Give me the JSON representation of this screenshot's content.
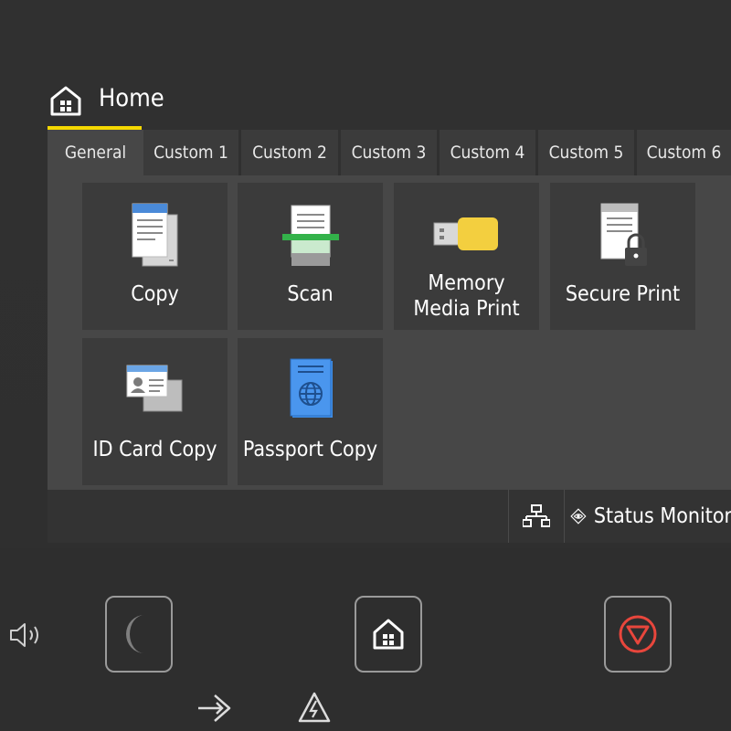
{
  "header": {
    "title": "Home",
    "icon": "home-icon"
  },
  "tabs": [
    {
      "label": "General",
      "active": true
    },
    {
      "label": "Custom 1"
    },
    {
      "label": "Custom 2"
    },
    {
      "label": "Custom 3"
    },
    {
      "label": "Custom 4"
    },
    {
      "label": "Custom 5"
    },
    {
      "label": "Custom 6"
    }
  ],
  "tiles": [
    {
      "label": "Copy",
      "icon": "copy-icon"
    },
    {
      "label": "Scan",
      "icon": "scan-icon"
    },
    {
      "label_line1": "Memory",
      "label_line2": "Media Print",
      "icon": "usb-memory-icon"
    },
    {
      "label": "Secure Print",
      "icon": "secure-print-icon"
    },
    {
      "label": "ID Card Copy",
      "icon": "id-card-icon"
    },
    {
      "label": "Passport Copy",
      "icon": "passport-icon"
    }
  ],
  "statusbar": {
    "status_label": "Status Monitor",
    "network_icon": "network-icon",
    "status_icon": "eye-icon"
  },
  "hardware": {
    "volume_icon": "speaker-icon",
    "sleep_icon": "moon-icon",
    "home_icon": "home-icon",
    "stop_icon": "stop-icon",
    "login_icon": "login-icon",
    "alert_icon": "alert-icon"
  },
  "colors": {
    "accent": "#f5d800",
    "stop": "#e8463c",
    "scan_green": "#33b24a",
    "usb_yellow": "#f3cf3f",
    "passport_blue": "#3f8ee8"
  }
}
